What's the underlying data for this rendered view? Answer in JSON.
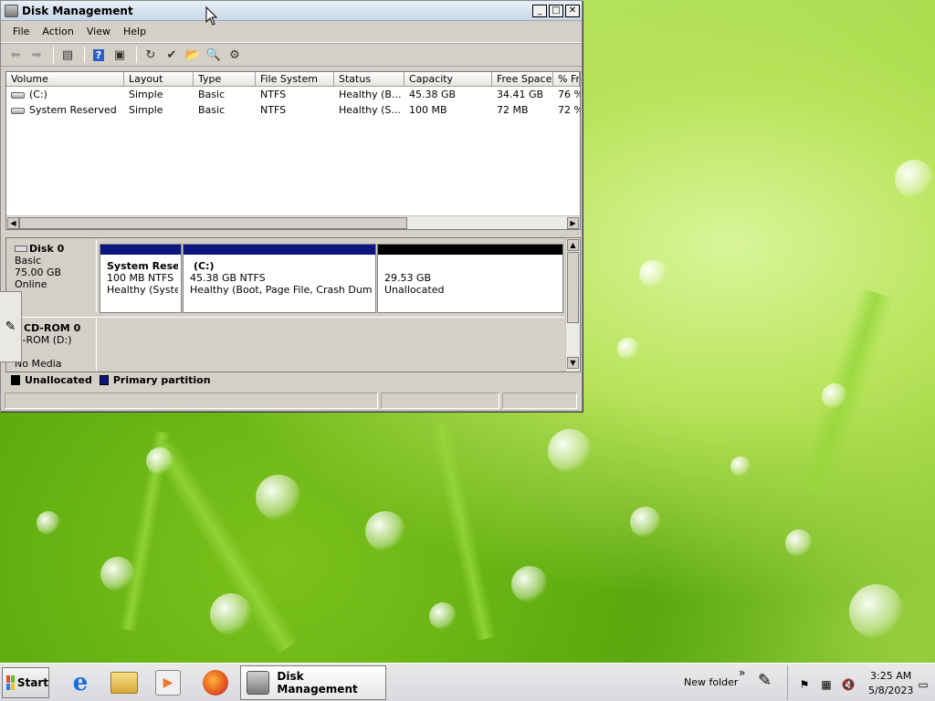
{
  "window": {
    "title": "Disk Management",
    "minimize": "_",
    "maximize": "□",
    "close": "✕"
  },
  "menu": [
    "File",
    "Action",
    "View",
    "Help"
  ],
  "toolbar_icons": [
    "back-arrow-icon",
    "forward-arrow-icon",
    "show-hide-tree-icon",
    "help-icon",
    "properties-icon",
    "refresh-icon",
    "export-icon",
    "open-folder-icon",
    "search-icon",
    "settings-icon"
  ],
  "volume_list": {
    "columns": [
      "Volume",
      "Layout",
      "Type",
      "File System",
      "Status",
      "Capacity",
      "Free Space",
      "% Fr"
    ],
    "rows": [
      [
        "(C:)",
        "Simple",
        "Basic",
        "NTFS",
        "Healthy (B...",
        "45.38 GB",
        "34.41 GB",
        "76 %"
      ],
      [
        "System Reserved",
        "Simple",
        "Basic",
        "NTFS",
        "Healthy (S...",
        "100 MB",
        "72 MB",
        "72 %"
      ]
    ]
  },
  "disk0": {
    "name": "Disk 0",
    "type": "Basic",
    "size": "75.00 GB",
    "status": "Online",
    "partitions": [
      {
        "title": "System Rese",
        "size": "100 MB NTFS",
        "status": "Healthy (Systen"
      },
      {
        "title": "(C:)",
        "size": "45.38 GB NTFS",
        "status": "Healthy (Boot, Page File, Crash Dump, Pr"
      },
      {
        "title": "",
        "size": "29.53 GB",
        "status": "Unallocated"
      }
    ]
  },
  "cdrom0": {
    "name": "CD-ROM 0",
    "drive": "D-ROM (D:)",
    "media": "No Media"
  },
  "legend": {
    "unallocated": "Unallocated",
    "primary": "Primary partition"
  },
  "colors": {
    "primary": "#0c1580",
    "unallocated": "#000000"
  },
  "taskbar": {
    "start": "Start",
    "task": "Disk Management",
    "folder": "New folder",
    "chevron": "»",
    "time": "3:25 AM",
    "date": "5/8/2023"
  }
}
